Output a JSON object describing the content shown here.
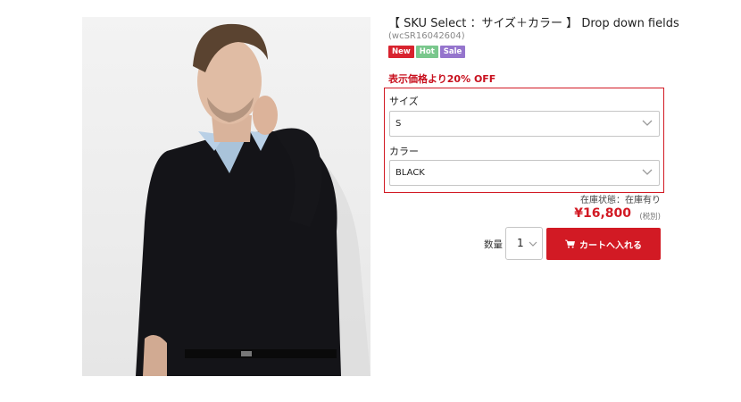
{
  "product": {
    "title": "【 SKU Select ：サイズ＋カラー 】 Drop down fields",
    "sku": "(wcSR16042604)",
    "badges": [
      {
        "label": "New",
        "color": "#d8222e"
      },
      {
        "label": "Hot",
        "color": "#79c78c"
      },
      {
        "label": "Sale",
        "color": "#9575cd"
      }
    ],
    "discount_text": "表示価格より20% OFF",
    "image_icon": "model-photo"
  },
  "options": {
    "size": {
      "label": "サイズ",
      "value": "S"
    },
    "color": {
      "label": "カラー",
      "value": "BLACK"
    }
  },
  "purchase": {
    "stock": "在庫状態：在庫有り",
    "price": "¥16,800",
    "tax": "(税別)",
    "qty_label": "数量",
    "qty_value": "1",
    "cart_label": "カートへ入れる",
    "cart_icon": "cart-icon"
  },
  "colors": {
    "accent": "#d21a24"
  }
}
